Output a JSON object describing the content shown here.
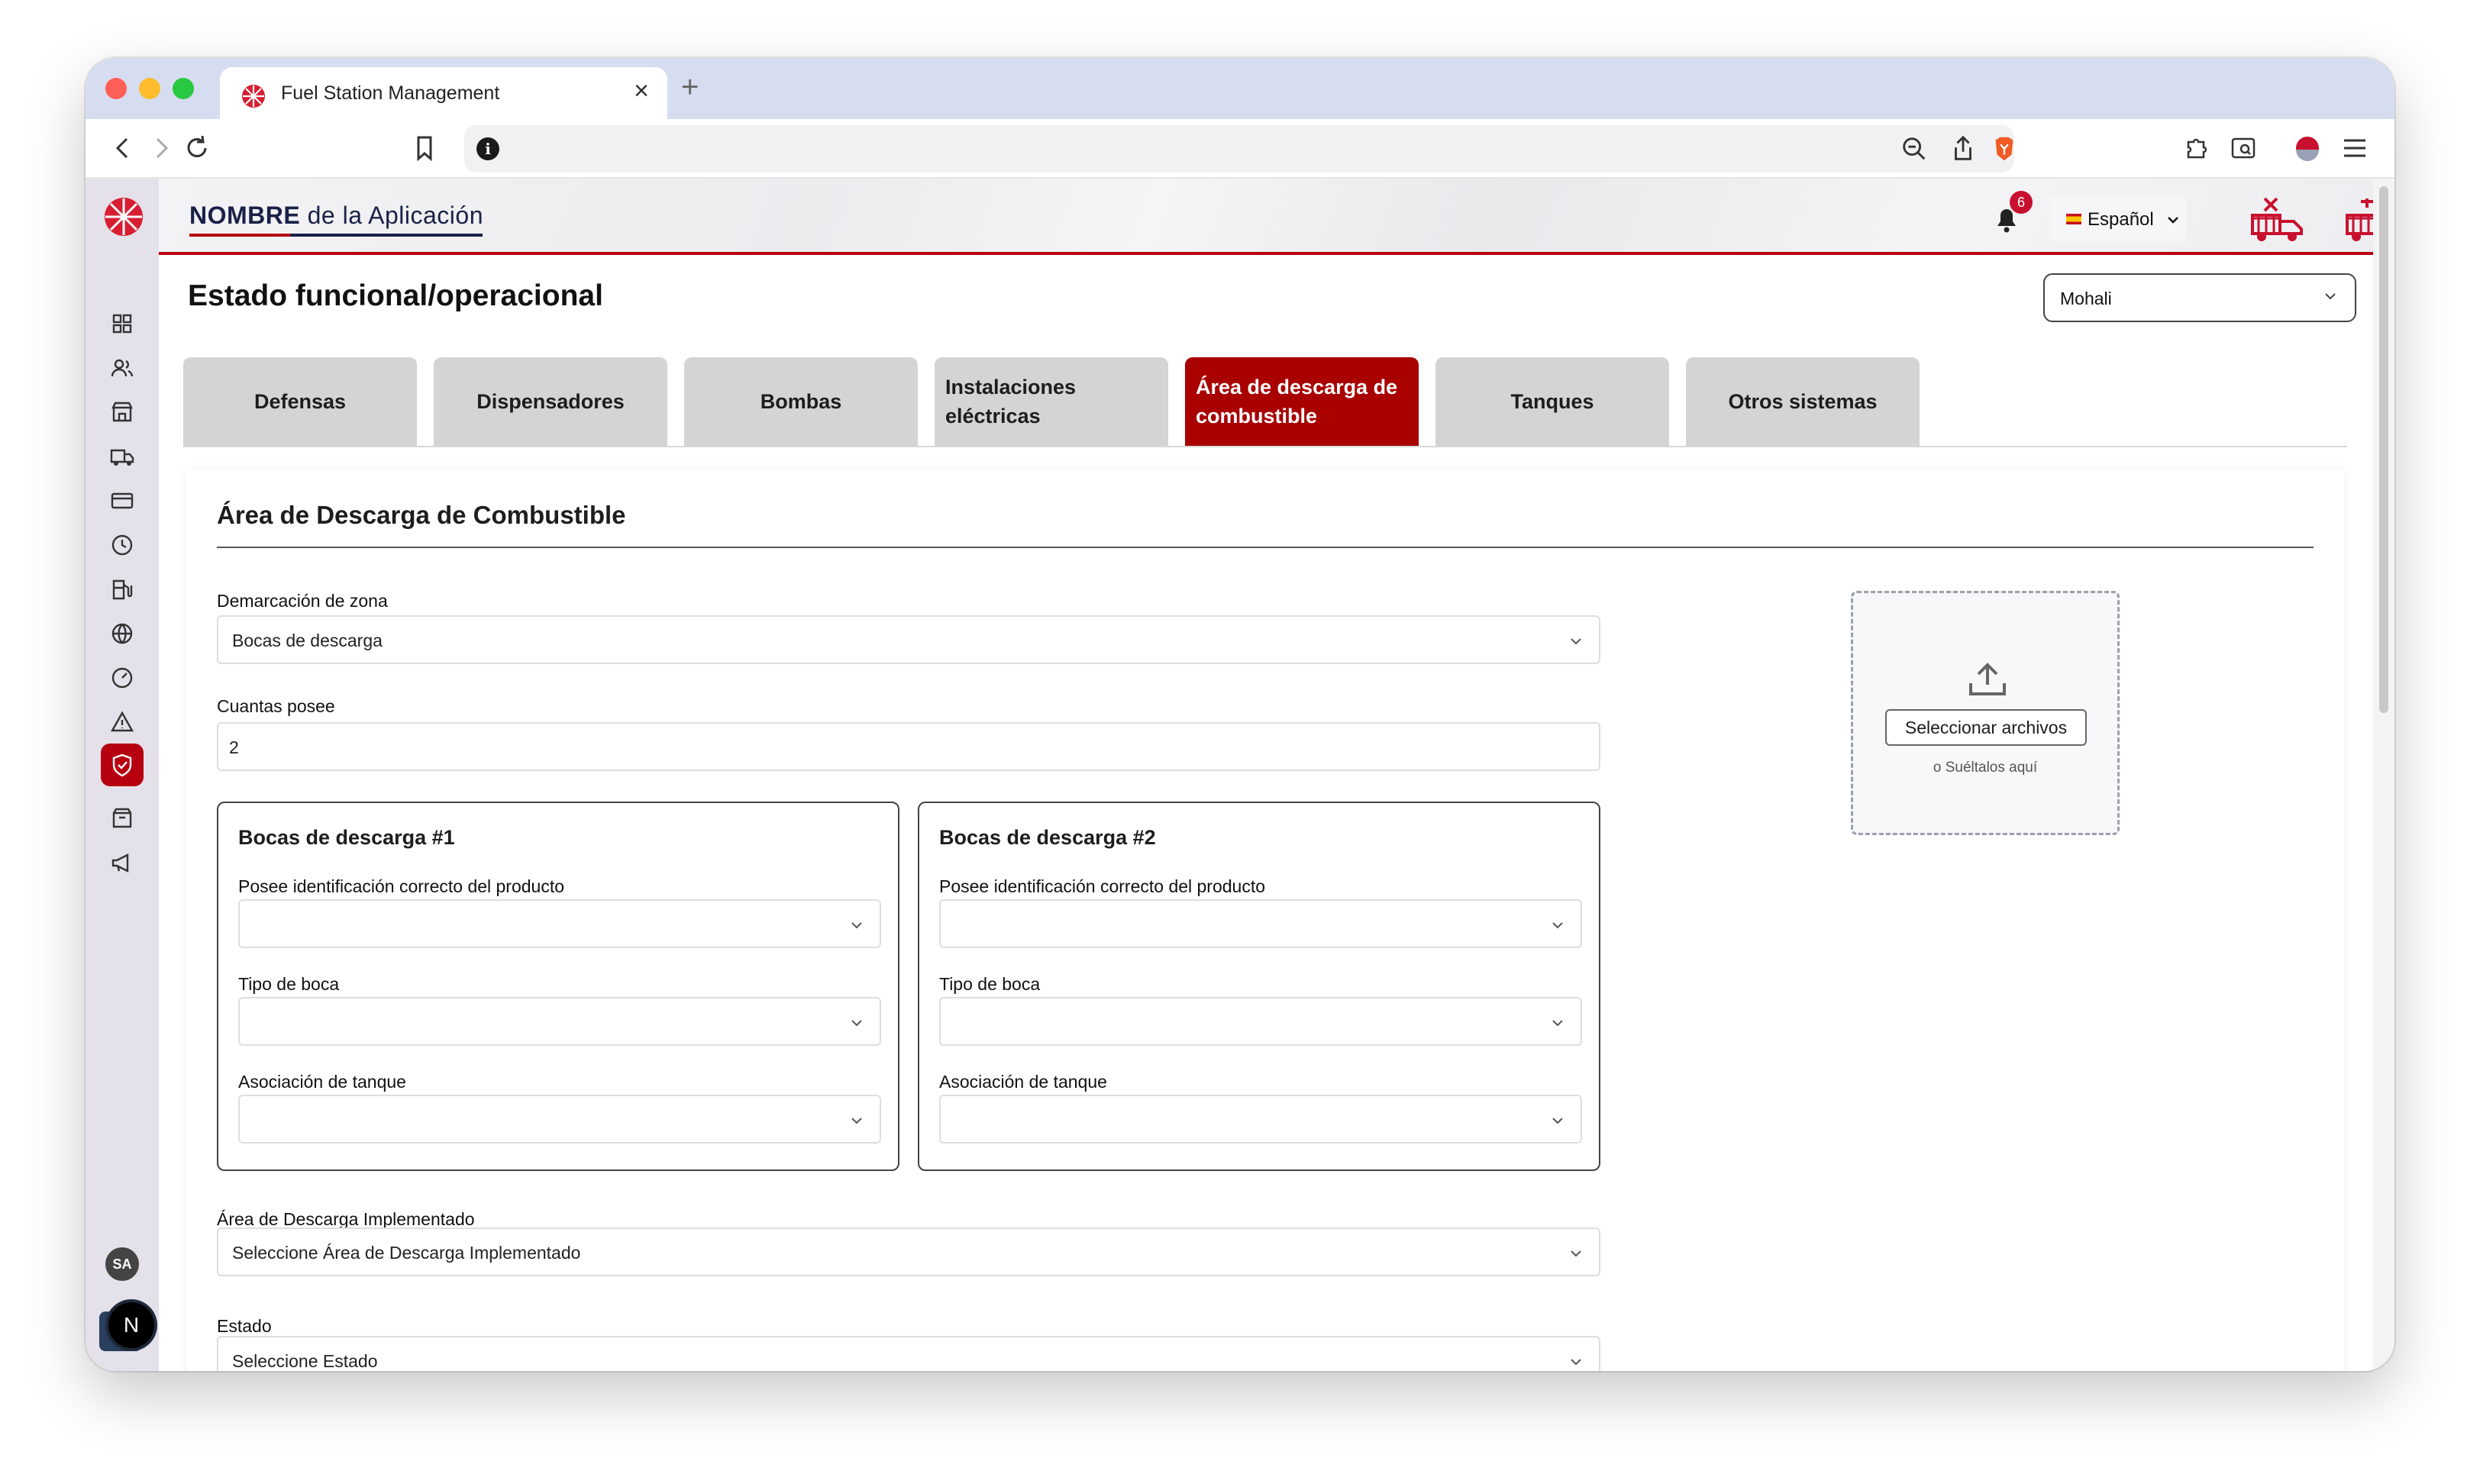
{
  "browser": {
    "tab_title": "Fuel Station Management",
    "tab_close": "×",
    "new_tab": "+"
  },
  "header": {
    "app_name_bold": "NOMBRE",
    "app_name_rest": " de la Aplicación",
    "notification_count": "6",
    "language": "Español"
  },
  "page": {
    "title": "Estado funcional/operacional",
    "site_select_value": "Mohali"
  },
  "tabs": [
    {
      "label": "Defensas",
      "active": false
    },
    {
      "label": "Dispensadores",
      "active": false
    },
    {
      "label": "Bombas",
      "active": false
    },
    {
      "label": "Instalaciones eléctricas",
      "active": false
    },
    {
      "label": "Área de descarga de combustible",
      "active": true
    },
    {
      "label": "Tanques",
      "active": false
    },
    {
      "label": "Otros sistemas",
      "active": false
    }
  ],
  "form": {
    "section_title": "Área de Descarga de Combustible",
    "zona_label": "Demarcación de zona",
    "zona_value": "Bocas de descarga",
    "cuantas_label": "Cuantas posee",
    "cuantas_value": "2",
    "bocas": [
      {
        "title": "Bocas de descarga #1",
        "identificacion_label": "Posee identificación correcto del producto",
        "identificacion_value": "",
        "tipo_label": "Tipo de boca",
        "tipo_value": "",
        "tanque_label": "Asociación de tanque",
        "tanque_value": ""
      },
      {
        "title": "Bocas de descarga #2",
        "identificacion_label": "Posee identificación correcto del producto",
        "identificacion_value": "",
        "tipo_label": "Tipo de boca",
        "tipo_value": "",
        "tanque_label": "Asociación de tanque",
        "tanque_value": ""
      }
    ],
    "implementado_label": "Área de Descarga Implementado",
    "implementado_placeholder": "Seleccione Área de Descarga Implementado",
    "estado_label": "Estado",
    "estado_placeholder": "Seleccione Estado"
  },
  "upload": {
    "button_label": "Seleccionar archivos",
    "hint": "o Suéltalos aquí"
  },
  "sidebar": {
    "avatar_initials": "SA",
    "next_badge": "N"
  },
  "colors": {
    "brand_red": "#b7000f",
    "active_tab": "#a90000",
    "navy": "#1a2148"
  }
}
